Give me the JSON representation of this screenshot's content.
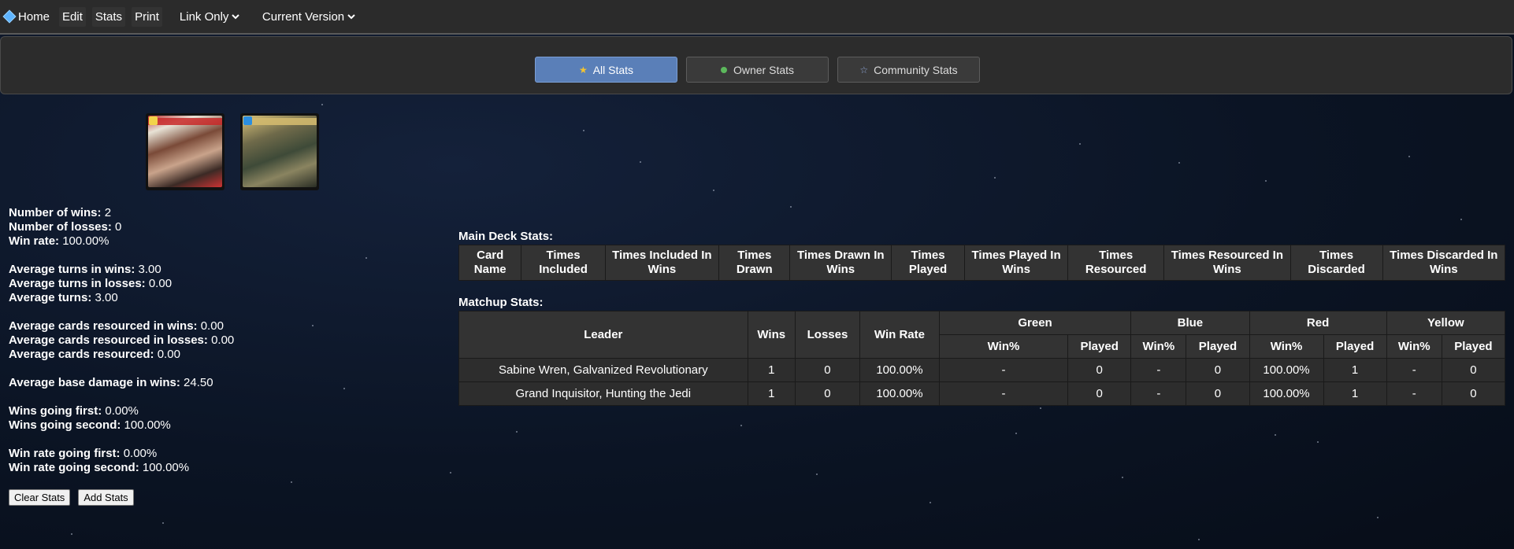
{
  "nav": {
    "home": "Home",
    "edit": "Edit",
    "stats": "Stats",
    "print": "Print",
    "sharing": "Link Only",
    "version": "Current Version"
  },
  "tabs": {
    "all": "All Stats",
    "owner": "Owner Stats",
    "community": "Community Stats"
  },
  "cards": [
    {
      "name": "Boba Fett leader card"
    },
    {
      "name": "base card"
    }
  ],
  "summary": {
    "wins_label": "Number of wins:",
    "wins": "2",
    "losses_label": "Number of losses:",
    "losses": "0",
    "winrate_label": "Win rate:",
    "winrate": "100.00%",
    "avg_turns_wins_label": "Average turns in wins:",
    "avg_turns_wins": "3.00",
    "avg_turns_losses_label": "Average turns in losses:",
    "avg_turns_losses": "0.00",
    "avg_turns_label": "Average turns:",
    "avg_turns": "3.00",
    "avg_res_wins_label": "Average cards resourced in wins:",
    "avg_res_wins": "0.00",
    "avg_res_losses_label": "Average cards resourced in losses:",
    "avg_res_losses": "0.00",
    "avg_res_label": "Average cards resourced:",
    "avg_res": "0.00",
    "avg_dmg_label": "Average base damage in wins:",
    "avg_dmg": "24.50",
    "wins_first_label": "Wins going first:",
    "wins_first": "0.00%",
    "wins_second_label": "Wins going second:",
    "wins_second": "100.00%",
    "wr_first_label": "Win rate going first:",
    "wr_first": "0.00%",
    "wr_second_label": "Win rate going second:",
    "wr_second": "100.00%"
  },
  "buttons": {
    "clear": "Clear Stats",
    "add": "Add Stats"
  },
  "main_deck": {
    "title": "Main Deck Stats:",
    "headers": [
      "Card Name",
      "Times Included",
      "Times Included In Wins",
      "Times Drawn",
      "Times Drawn In Wins",
      "Times Played",
      "Times Played In Wins",
      "Times Resourced",
      "Times Resourced In Wins",
      "Times Discarded",
      "Times Discarded In Wins"
    ]
  },
  "matchup": {
    "title": "Matchup Stats:",
    "h_leader": "Leader",
    "h_wins": "Wins",
    "h_losses": "Losses",
    "h_winrate": "Win Rate",
    "colors": [
      "Green",
      "Blue",
      "Red",
      "Yellow"
    ],
    "sub_winpct": "Win%",
    "sub_played": "Played",
    "rows": [
      {
        "leader": "Sabine Wren, Galvanized Revolutionary",
        "wins": "1",
        "losses": "0",
        "winrate": "100.00%",
        "green_pct": "-",
        "green_played": "0",
        "blue_pct": "-",
        "blue_played": "0",
        "red_pct": "100.00%",
        "red_played": "1",
        "yellow_pct": "-",
        "yellow_played": "0"
      },
      {
        "leader": "Grand Inquisitor, Hunting the Jedi",
        "wins": "1",
        "losses": "0",
        "winrate": "100.00%",
        "green_pct": "-",
        "green_played": "0",
        "blue_pct": "-",
        "blue_played": "0",
        "red_pct": "100.00%",
        "red_played": "1",
        "yellow_pct": "-",
        "yellow_played": "0"
      }
    ]
  }
}
